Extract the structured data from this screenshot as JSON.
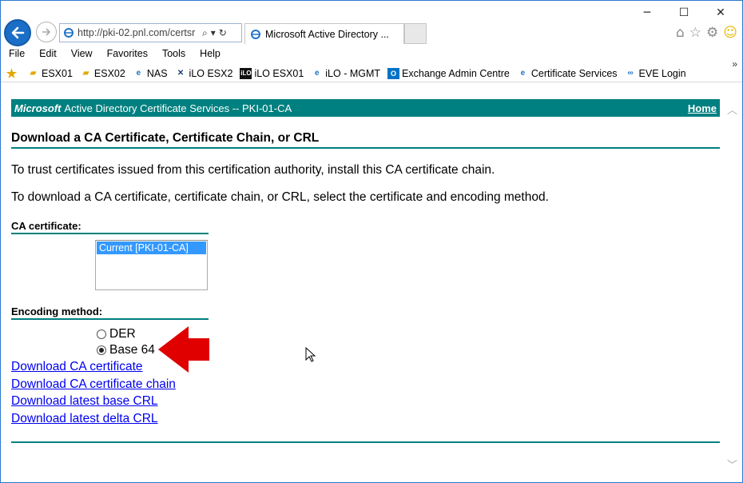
{
  "window": {
    "minimize": "─",
    "maximize": "☐",
    "close": "✕"
  },
  "address": {
    "url": "http://pki-02.pnl.com/certsr",
    "search_glyph": "⌕",
    "dropdown_glyph": "▾",
    "refresh_glyph": "↻"
  },
  "tab": {
    "title": "Microsoft Active Directory ...",
    "close": "✕"
  },
  "menu": [
    "File",
    "Edit",
    "View",
    "Favorites",
    "Tools",
    "Help"
  ],
  "favorites": [
    {
      "label": "ESX01",
      "icon": "key-icon"
    },
    {
      "label": "ESX02",
      "icon": "key-icon"
    },
    {
      "label": "NAS",
      "icon": "ie-page-icon"
    },
    {
      "label": "iLO ESX2",
      "icon": "server-icon"
    },
    {
      "label": "iLO ESX01",
      "icon": "ilo-icon"
    },
    {
      "label": "iLO - MGMT",
      "icon": "ie-page-icon"
    },
    {
      "label": "Exchange Admin Centre",
      "icon": "outlook-icon"
    },
    {
      "label": "Certificate Services",
      "icon": "ie-page-icon"
    },
    {
      "label": "EVE  Login",
      "icon": "eve-icon"
    }
  ],
  "page": {
    "banner_brand": "Microsoft",
    "banner_text": "Active Directory Certificate Services  --  PKI-01-CA",
    "home_link": "Home",
    "heading": "Download a CA Certificate, Certificate Chain, or CRL",
    "para1": "To trust certificates issued from this certification authority, install this CA certificate chain.",
    "para2": "To download a CA certificate, certificate chain, or CRL, select the certificate and encoding method.",
    "ca_label": "CA certificate:",
    "ca_options": [
      "Current [PKI-01-CA]"
    ],
    "encoding_label": "Encoding method:",
    "encoding_options": [
      {
        "label": "DER",
        "selected": false
      },
      {
        "label": "Base 64",
        "selected": true
      }
    ],
    "links": [
      "Download CA certificate",
      "Download CA certificate chain",
      "Download latest base CRL",
      "Download latest delta CRL"
    ]
  },
  "colors": {
    "accent": "#008080",
    "link": "#0000ee",
    "selection": "#3399ff",
    "annotation_arrow": "#e00000"
  }
}
